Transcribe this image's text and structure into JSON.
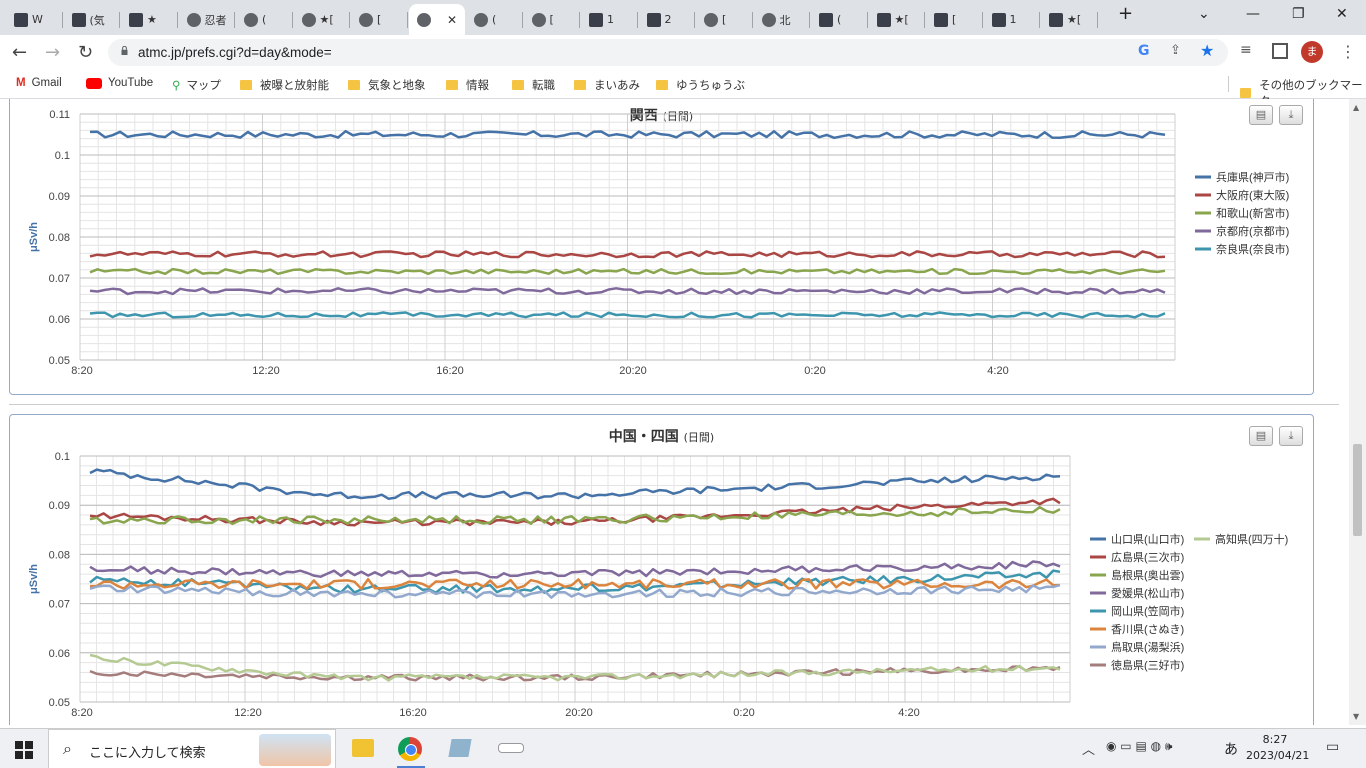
{
  "browser": {
    "tabs": [
      {
        "label": "W",
        "icon": "dark"
      },
      {
        "label": "(気",
        "icon": "dark"
      },
      {
        "label": "★",
        "icon": "dark"
      },
      {
        "label": "忍者",
        "icon": "globe"
      },
      {
        "label": "(",
        "icon": "globe"
      },
      {
        "label": "★[",
        "icon": "globe"
      },
      {
        "label": "[",
        "icon": "globe"
      },
      {
        "label": "",
        "icon": "globe",
        "active": true
      },
      {
        "label": "(",
        "icon": "globe"
      },
      {
        "label": "[",
        "icon": "globe"
      },
      {
        "label": "1",
        "icon": "dark"
      },
      {
        "label": "2",
        "icon": "dark"
      },
      {
        "label": "[",
        "icon": "globe"
      },
      {
        "label": "北",
        "icon": "globe"
      },
      {
        "label": "(",
        "icon": "dark"
      },
      {
        "label": "★[",
        "icon": "dark"
      },
      {
        "label": "[",
        "icon": "dark"
      },
      {
        "label": "1",
        "icon": "dark"
      },
      {
        "label": "★[",
        "icon": "dark"
      }
    ],
    "url": "atmc.jp/prefs.cgi?d=day&mode=",
    "profile_initial": "ま",
    "bookmarks": [
      "Gmail",
      "YouTube",
      "マップ",
      "被曝と放射能",
      "気象と地象",
      "情報",
      "転職",
      "まいあみ",
      "ゆうちゅうぶ"
    ],
    "other_bookmarks": "その他のブックマーク"
  },
  "charts": [
    {
      "title": "関西",
      "subtitle": "(日間)",
      "ylabel": "μSv/h",
      "yticks": [
        "0.11",
        "0.1",
        "0.09",
        "0.08",
        "0.07",
        "0.06",
        "0.05"
      ],
      "xticks": [
        "8:20",
        "12:20",
        "16:20",
        "20:20",
        "0:20",
        "4:20"
      ],
      "legend": [
        {
          "name": "兵庫県(神戸市)",
          "color": "#4572a7"
        },
        {
          "name": "大阪府(東大阪)",
          "color": "#aa4643"
        },
        {
          "name": "和歌山(新宮市)",
          "color": "#89a54e"
        },
        {
          "name": "京都府(京都市)",
          "color": "#80699b"
        },
        {
          "name": "奈良県(奈良市)",
          "color": "#3d96ae"
        }
      ]
    },
    {
      "title": "中国・四国",
      "subtitle": "(日間)",
      "ylabel": "μSv/h",
      "yticks": [
        "0.1",
        "0.09",
        "0.08",
        "0.07",
        "0.06",
        "0.05"
      ],
      "xticks": [
        "8:20",
        "12:20",
        "16:20",
        "20:20",
        "0:20",
        "4:20"
      ],
      "legend": [
        {
          "name": "山口県(山口市)",
          "color": "#4572a7"
        },
        {
          "name": "広島県(三次市)",
          "color": "#aa4643"
        },
        {
          "name": "島根県(奥出雲)",
          "color": "#89a54e"
        },
        {
          "name": "愛媛県(松山市)",
          "color": "#80699b"
        },
        {
          "name": "岡山県(笠岡市)",
          "color": "#3d96ae"
        },
        {
          "name": "香川県(さぬき)",
          "color": "#db843d"
        },
        {
          "name": "鳥取県(湯梨浜)",
          "color": "#92a8cd"
        },
        {
          "name": "徳島県(三好市)",
          "color": "#a47d7c"
        },
        {
          "name": "高知県(四万十)",
          "color": "#b5ca92"
        }
      ]
    }
  ],
  "chart_data": [
    {
      "type": "line",
      "title": "関西",
      "subtitle": "(日間)",
      "ylabel": "μSv/h",
      "ylim": [
        0.05,
        0.11
      ],
      "x_ticks": [
        "8:20",
        "12:20",
        "16:20",
        "20:20",
        "0:20",
        "4:20"
      ],
      "series": [
        {
          "name": "兵庫県(神戸市)",
          "color": "#4572a7",
          "base": 0.105,
          "noise": 0.0008
        },
        {
          "name": "大阪府(東大阪)",
          "color": "#aa4643",
          "base": 0.0758,
          "noise": 0.0007
        },
        {
          "name": "和歌山(新宮市)",
          "color": "#89a54e",
          "base": 0.0716,
          "noise": 0.0006
        },
        {
          "name": "京都府(京都市)",
          "color": "#80699b",
          "base": 0.0668,
          "noise": 0.0007
        },
        {
          "name": "奈良県(奈良市)",
          "color": "#3d96ae",
          "base": 0.061,
          "noise": 0.0006
        }
      ]
    },
    {
      "type": "line",
      "title": "中国・四国",
      "subtitle": "(日間)",
      "ylabel": "μSv/h",
      "ylim": [
        0.05,
        0.1
      ],
      "x_ticks": [
        "8:20",
        "12:20",
        "16:20",
        "20:20",
        "0:20",
        "4:20"
      ],
      "series": [
        {
          "name": "山口県(山口市)",
          "color": "#4572a7",
          "start": 0.097,
          "mid": 0.092,
          "end": 0.096,
          "noise": 0.0007
        },
        {
          "name": "広島県(三次市)",
          "color": "#aa4643",
          "start": 0.088,
          "mid": 0.0865,
          "end": 0.091,
          "noise": 0.0006
        },
        {
          "name": "島根県(奥出雲)",
          "color": "#89a54e",
          "start": 0.087,
          "mid": 0.087,
          "end": 0.089,
          "noise": 0.0008
        },
        {
          "name": "愛媛県(松山市)",
          "color": "#80699b",
          "start": 0.077,
          "mid": 0.076,
          "end": 0.078,
          "noise": 0.0007
        },
        {
          "name": "岡山県(笠岡市)",
          "color": "#3d96ae",
          "start": 0.075,
          "mid": 0.073,
          "end": 0.076,
          "noise": 0.0008
        },
        {
          "name": "香川県(さぬき)",
          "color": "#db843d",
          "start": 0.074,
          "mid": 0.074,
          "end": 0.074,
          "noise": 0.001
        },
        {
          "name": "鳥取県(湯梨浜)",
          "color": "#92a8cd",
          "start": 0.073,
          "mid": 0.072,
          "end": 0.073,
          "noise": 0.0008
        },
        {
          "name": "徳島県(三好市)",
          "color": "#a47d7c",
          "start": 0.056,
          "mid": 0.055,
          "end": 0.057,
          "noise": 0.0006
        },
        {
          "name": "高知県(四万十)",
          "color": "#b5ca92",
          "start": 0.059,
          "mid": 0.055,
          "end": 0.057,
          "noise": 0.0006
        }
      ]
    }
  ],
  "taskbar": {
    "search_placeholder": "ここに入力して検索",
    "time": "8:27",
    "date": "2023/04/21",
    "ime": "あ"
  }
}
